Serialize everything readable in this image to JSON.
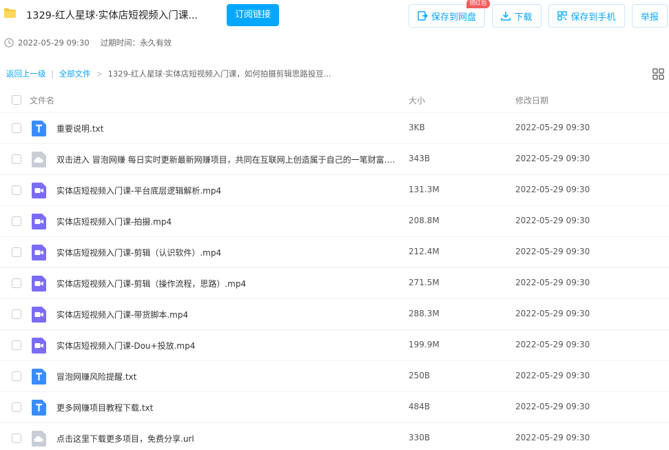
{
  "header": {
    "title": "1329-红人星球·实体店短视频入门课...",
    "subscribe_label": "订阅链接",
    "save_label": "保存到网盘",
    "download_label": "下载",
    "phone_label": "保存到手机",
    "report_label": "举报",
    "badge_label": "领红包"
  },
  "meta": {
    "share_time": "2022-05-29 09:30",
    "expire_label": "过期时间：永久有效"
  },
  "breadcrumb": {
    "back_label": "返回上一级",
    "all_files_label": "全部文件",
    "separator": ">",
    "current_label": "1329-红人星球·实体店短视频入门课，如何拍摄剪辑思路投豆..."
  },
  "columns": {
    "name": "文件名",
    "size": "大小",
    "date": "修改日期"
  },
  "icons": {
    "txt": "text-file-icon",
    "url": "cloud-link-file-icon",
    "video": "video-file-icon"
  },
  "colors": {
    "accent": "#06a7ff",
    "txt_icon": "#3b8cff",
    "video_icon": "#7b6cf6",
    "url_icon": "#c9ced6",
    "badge": "#f25d5d"
  },
  "files": [
    {
      "name": "重要说明.txt",
      "size": "3KB",
      "date": "2022-05-29 09:30",
      "type": "txt"
    },
    {
      "name": "双击进入 冒泡网赚 每日实时更新最新网赚项目，共同在互联网上创造属于自己的一笔财富.url",
      "size": "343B",
      "date": "2022-05-29 09:30",
      "type": "url"
    },
    {
      "name": "实体店短视频入门课-平台底层逻辑解析.mp4",
      "size": "131.3M",
      "date": "2022-05-29 09:30",
      "type": "video"
    },
    {
      "name": "实体店短视频入门课-拍摄.mp4",
      "size": "208.8M",
      "date": "2022-05-29 09:30",
      "type": "video"
    },
    {
      "name": "实体店短视频入门课-剪辑（认识软件）.mp4",
      "size": "212.4M",
      "date": "2022-05-29 09:30",
      "type": "video"
    },
    {
      "name": "实体店短视频入门课-剪辑（操作流程，思路）.mp4",
      "size": "271.5M",
      "date": "2022-05-29 09:30",
      "type": "video"
    },
    {
      "name": "实体店短视频入门课-带货脚本.mp4",
      "size": "288.3M",
      "date": "2022-05-29 09:30",
      "type": "video"
    },
    {
      "name": "实体店短视频入门课-Dou+投放.mp4",
      "size": "199.9M",
      "date": "2022-05-29 09:30",
      "type": "video"
    },
    {
      "name": "冒泡网赚风险提醒.txt",
      "size": "250B",
      "date": "2022-05-29 09:30",
      "type": "txt"
    },
    {
      "name": "更多网赚项目教程下载.txt",
      "size": "484B",
      "date": "2022-05-29 09:30",
      "type": "txt"
    },
    {
      "name": "点击这里下载更多项目，免费分享.url",
      "size": "330B",
      "date": "2022-05-29 09:30",
      "type": "url"
    }
  ]
}
